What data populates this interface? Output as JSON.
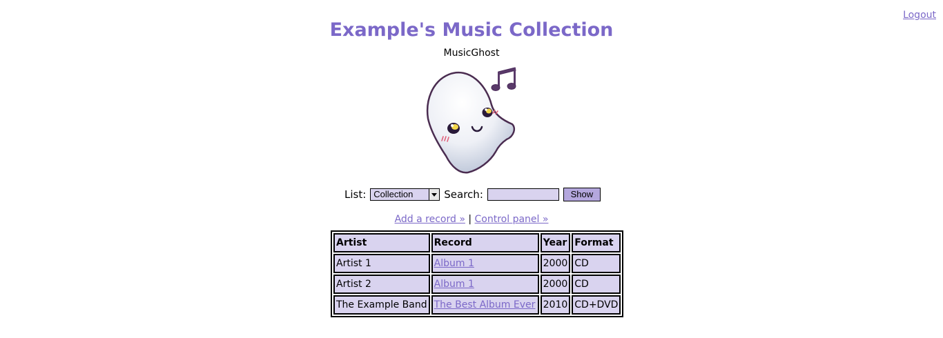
{
  "header": {
    "logout_label": "Logout",
    "title": "Example's Music Collection",
    "username": "MusicGhost"
  },
  "avatar": {
    "icon": "ghost-music-icon"
  },
  "controls": {
    "list_label": "List:",
    "list_selected": "Collection",
    "search_label": "Search:",
    "search_value": "",
    "show_label": "Show"
  },
  "links": {
    "add_record": "Add a record »",
    "separator": "|",
    "control_panel": "Control panel »"
  },
  "table": {
    "headers": [
      "Artist",
      "Record",
      "Year",
      "Format"
    ],
    "rows": [
      {
        "artist": "Artist 1",
        "record": "Album 1",
        "year": "2000",
        "format": "CD"
      },
      {
        "artist": "Artist 2",
        "record": "Album 1",
        "year": "2000",
        "format": "CD"
      },
      {
        "artist": "The Example Band",
        "record": "The Best Album Ever",
        "year": "2010",
        "format": "CD+DVD"
      }
    ]
  },
  "colors": {
    "accent": "#7b68c8",
    "cell_bg": "#d9d3ef",
    "button_bg": "#b4a7dd"
  }
}
